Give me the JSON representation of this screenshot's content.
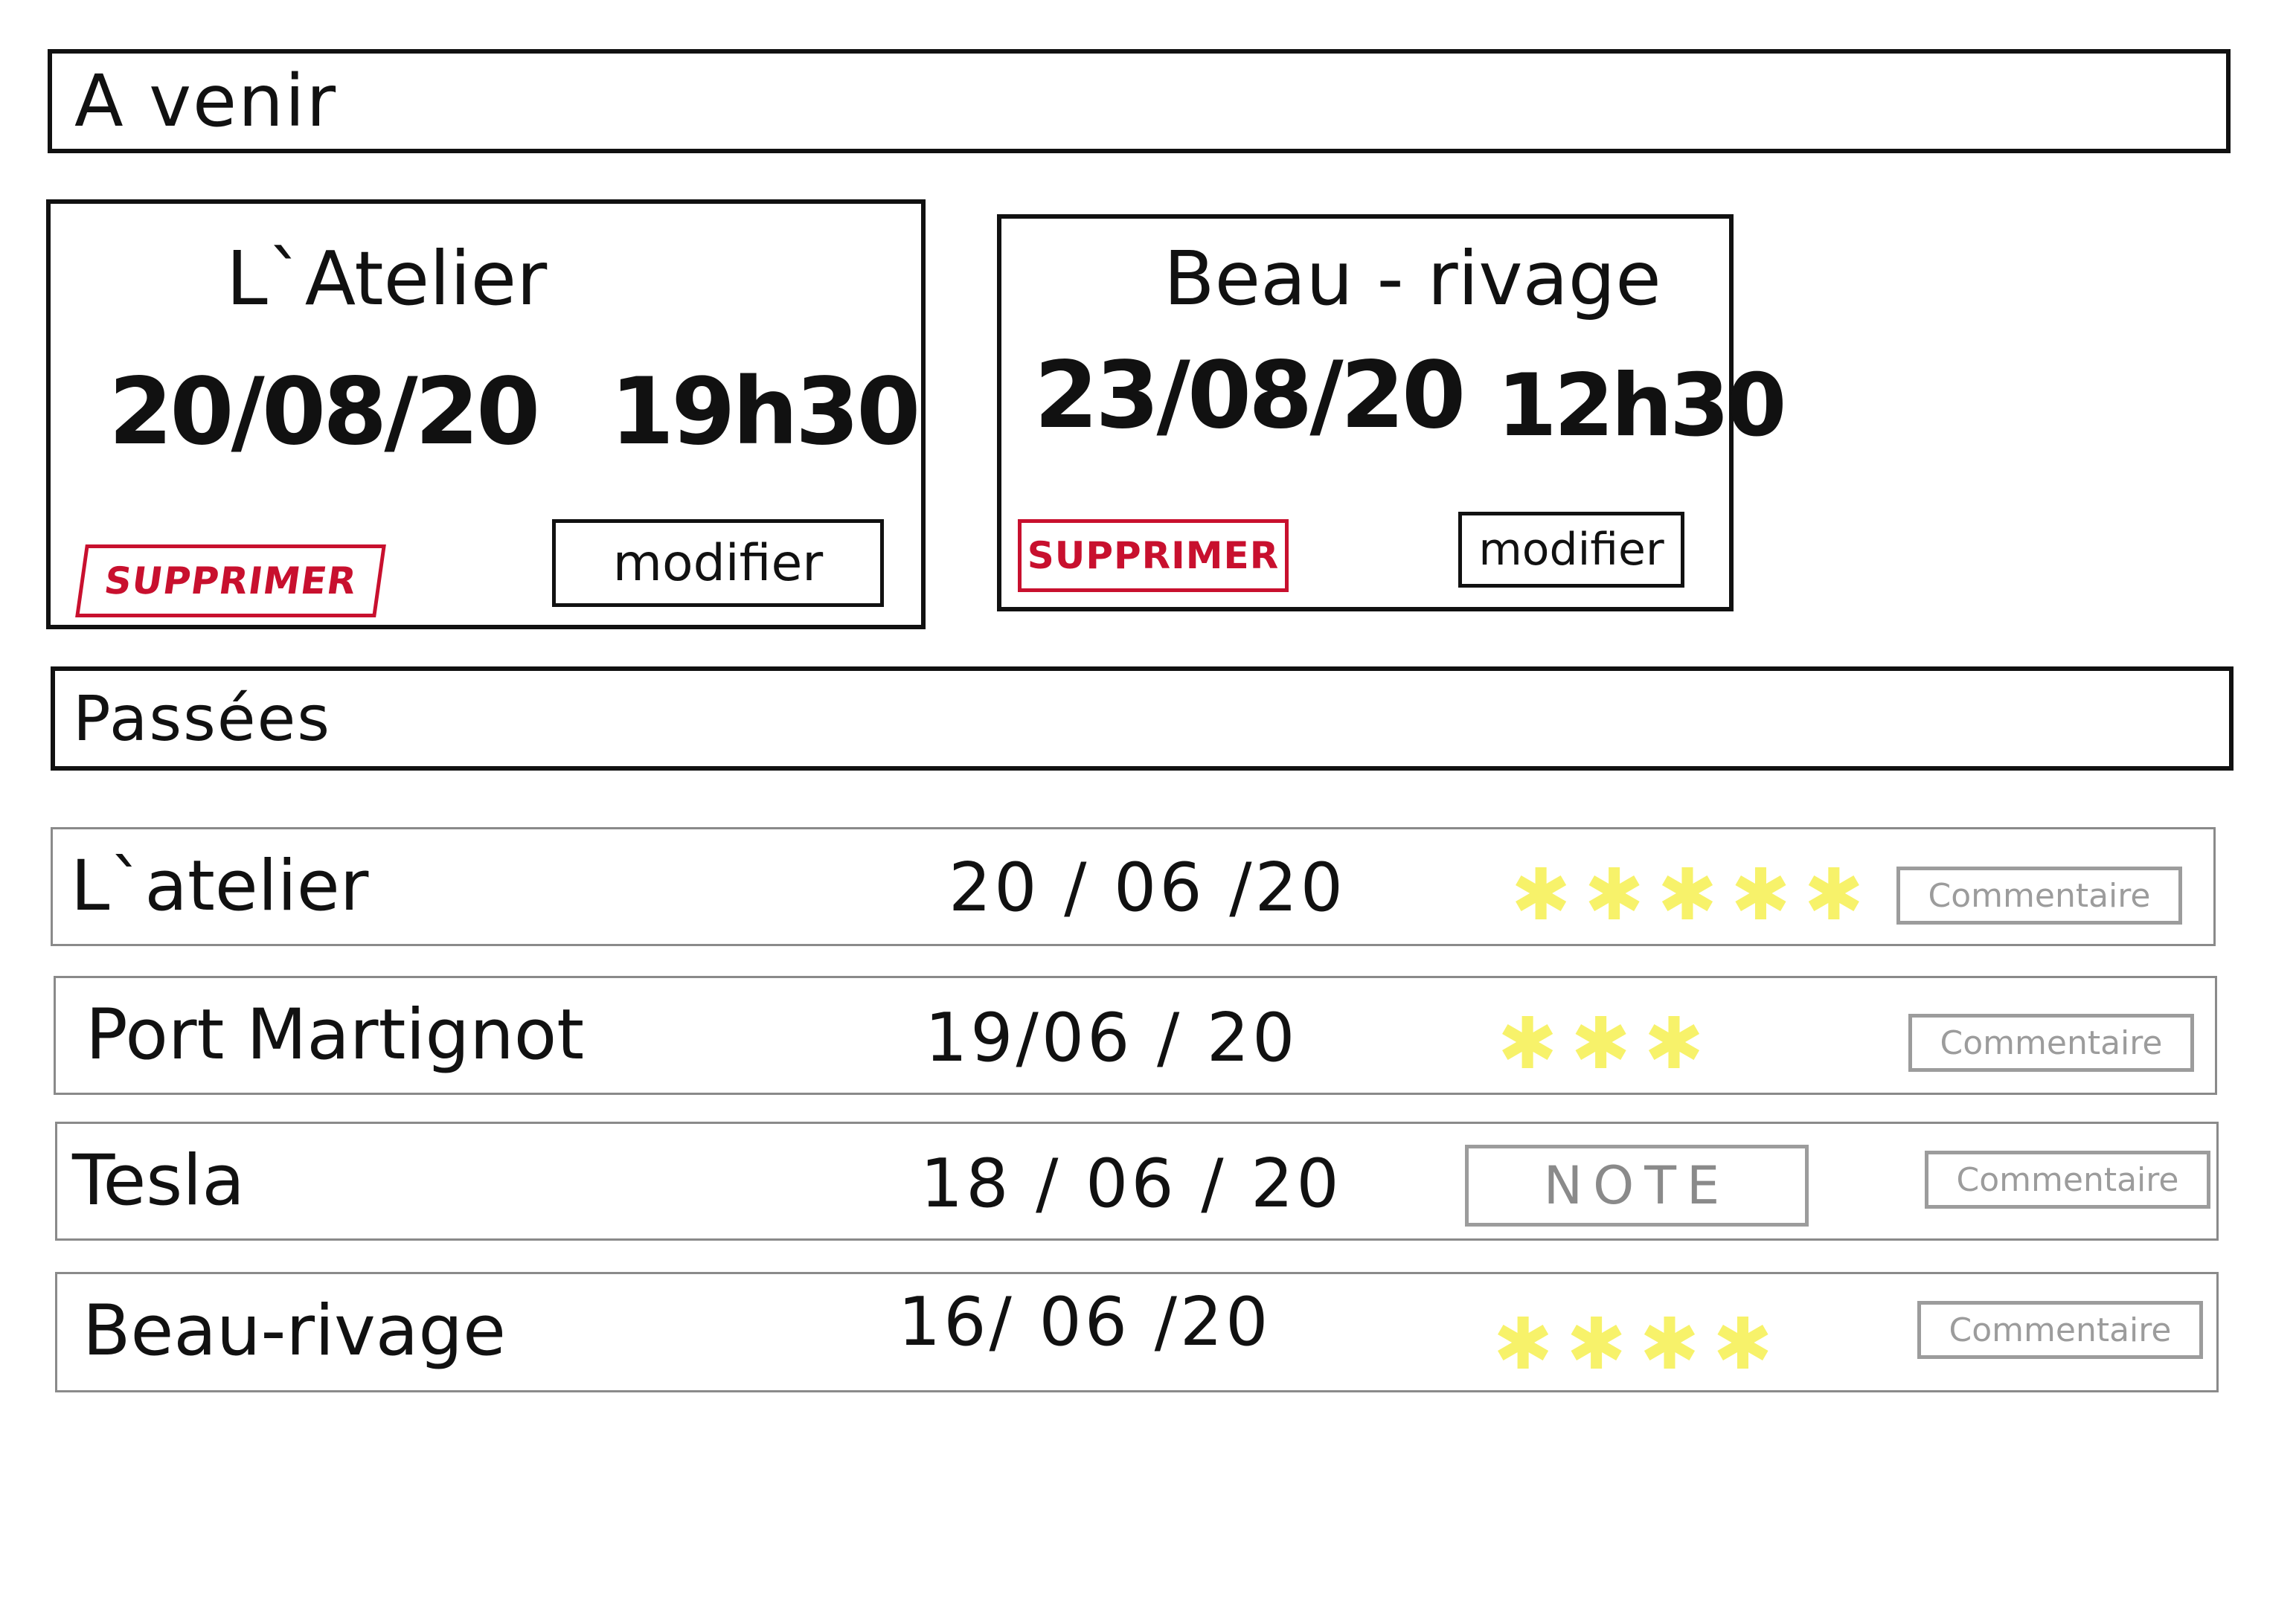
{
  "upcoming": {
    "title": "A venir",
    "cards": [
      {
        "name": "L`Atelier",
        "date": "20/08/20",
        "time": "19h30",
        "delete_label": "SUPPRIMER",
        "edit_label": "modifier"
      },
      {
        "name": "Beau - rivage",
        "date": "23/08/20",
        "time": "12h30",
        "delete_label": "SUPPRIMER",
        "edit_label": "modifier"
      }
    ]
  },
  "past": {
    "title": "Passées",
    "rows": [
      {
        "name": "L`atelier",
        "date": "20 / 06 /20",
        "rating": 5,
        "comment_label": "Commentaire"
      },
      {
        "name": "Port Martignot",
        "date": "19/06 / 20",
        "rating": 3,
        "comment_label": "Commentaire"
      },
      {
        "name": "Tesla",
        "date": "18 / 06 / 20",
        "note_label": "NOTE",
        "comment_label": "Commentaire"
      },
      {
        "name": "Beau-rivage",
        "date": "16/ 06 /20",
        "rating": 4,
        "comment_label": "Commentaire"
      }
    ]
  },
  "colors": {
    "delete": "#c8102e",
    "star": "#f7f26a",
    "muted": "#9c9c9c"
  },
  "icons": {
    "star": "asterisk-star-icon"
  }
}
